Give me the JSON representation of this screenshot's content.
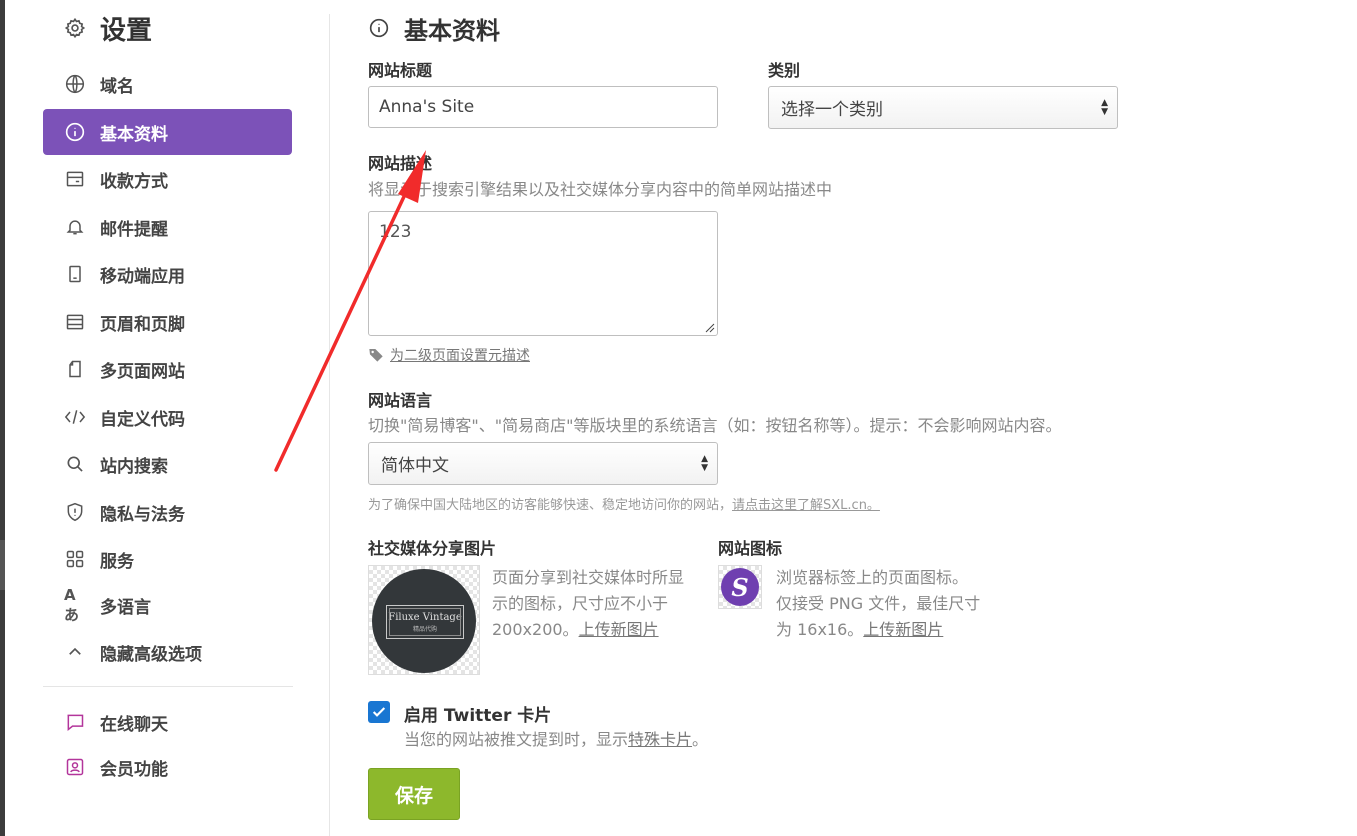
{
  "sidebar": {
    "title": "设置",
    "items": [
      {
        "label": "域名",
        "icon": "globe-icon"
      },
      {
        "label": "基本资料",
        "icon": "info-icon",
        "active": true
      },
      {
        "label": "收款方式",
        "icon": "payment-icon"
      },
      {
        "label": "邮件提醒",
        "icon": "bell-icon"
      },
      {
        "label": "移动端应用",
        "icon": "mobile-icon"
      },
      {
        "label": "页眉和页脚",
        "icon": "header-footer-icon"
      },
      {
        "label": "多页面网站",
        "icon": "pages-icon"
      },
      {
        "label": "自定义代码",
        "icon": "code-icon"
      },
      {
        "label": "站内搜索",
        "icon": "search-icon"
      },
      {
        "label": "隐私与法务",
        "icon": "shield-icon"
      },
      {
        "label": "服务",
        "icon": "grid-icon"
      },
      {
        "label": "多语言",
        "icon": "language-icon"
      },
      {
        "label": "隐藏高级选项",
        "icon": "chevron-up-icon"
      }
    ],
    "extras": [
      {
        "label": "在线聊天",
        "icon": "chat-icon"
      },
      {
        "label": "会员功能",
        "icon": "member-icon"
      }
    ],
    "active_color": "#7c52b8"
  },
  "main": {
    "title": "基本资料",
    "site_title": {
      "label": "网站标题",
      "value": "Anna's Site"
    },
    "category": {
      "label": "类别",
      "selected": "选择一个类别"
    },
    "description": {
      "label": "网站描述",
      "hint": "将显示于搜索引擎结果以及社交媒体分享内容中的简单网站描述中",
      "value": "123",
      "sub_link": "为二级页面设置元描述"
    },
    "language": {
      "label": "网站语言",
      "hint": "切换\"简易博客\"、\"简易商店\"等版块里的系统语言（如：按钮名称等）。提示：不会影响网站内容。",
      "selected": "简体中文",
      "note": "为了确保中国大陆地区的访客能够快速、稳定地访问你的网站，",
      "note_link": "请点击这里了解SXL.cn。"
    },
    "social_image": {
      "label": "社交媒体分享图片",
      "desc_line1": "页面分享到社交媒体时所显",
      "desc_line2": "示的图标，尺寸应不小于",
      "desc_line3": "200x200。",
      "upload": "上传新图片",
      "logo_name": "Filuxe Vintage",
      "logo_sub": "精品代购"
    },
    "favicon": {
      "label": "网站图标",
      "desc_line1": "浏览器标签上的页面图标。",
      "desc_line2": "仅接受 PNG 文件，最佳尺寸",
      "desc_line3": "为 16x16。",
      "upload": "上传新图片",
      "letter": "S"
    },
    "twitter": {
      "label": "启用 Twitter 卡片",
      "desc": "当您的网站被推文提到时，显示",
      "link": "特殊卡片",
      "desc_end": "。",
      "checked": true
    },
    "save_label": "保存",
    "save_color": "#8db82c"
  }
}
